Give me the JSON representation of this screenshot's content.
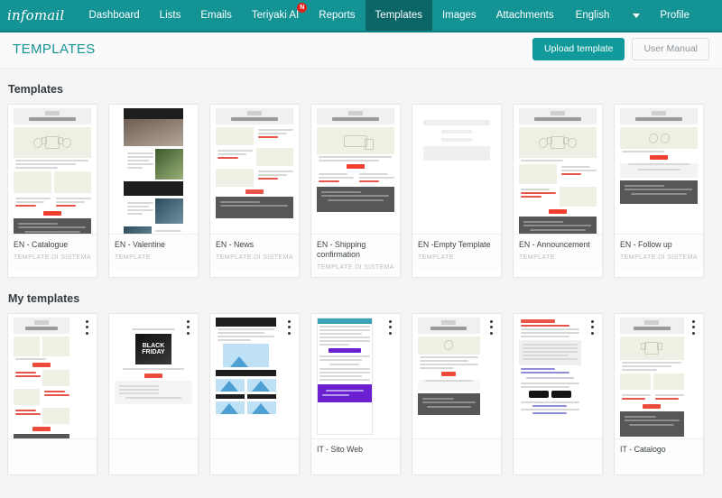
{
  "nav": {
    "logo": "infomail",
    "items": [
      {
        "label": "Dashboard",
        "active": false,
        "badge": null
      },
      {
        "label": "Lists",
        "active": false,
        "badge": null
      },
      {
        "label": "Emails",
        "active": false,
        "badge": null
      },
      {
        "label": "Teriyaki AI",
        "active": false,
        "badge": "N"
      },
      {
        "label": "Reports",
        "active": false,
        "badge": null
      },
      {
        "label": "Templates",
        "active": true,
        "badge": null
      },
      {
        "label": "Images",
        "active": false,
        "badge": null
      },
      {
        "label": "Attachments",
        "active": false,
        "badge": null
      }
    ],
    "language": "English",
    "profile": "Profile"
  },
  "header": {
    "title": "TEMPLATES",
    "upload_label": "Upload template",
    "manual_label": "User Manual"
  },
  "sections": [
    {
      "title": "Templates",
      "cards": [
        {
          "name": "EN - Catalogue",
          "kind": "TEMPLATE DI SISTEMA"
        },
        {
          "name": "EN - Valentine",
          "kind": "TEMPLATE"
        },
        {
          "name": "EN - News",
          "kind": "TEMPLATE DI SISTEMA"
        },
        {
          "name": "EN - Shipping confirmation",
          "kind": "TEMPLATE DI SISTEMA"
        },
        {
          "name": "EN -Empty Template",
          "kind": "TEMPLATE"
        },
        {
          "name": "EN - Announcement",
          "kind": "TEMPLATE"
        },
        {
          "name": "EN - Follow up",
          "kind": "TEMPLATE DI SISTEMA"
        }
      ]
    },
    {
      "title": "My templates",
      "cards": [
        {
          "name": "",
          "kind": ""
        },
        {
          "name": "",
          "kind": ""
        },
        {
          "name": "",
          "kind": ""
        },
        {
          "name": "IT - Sito Web",
          "kind": ""
        },
        {
          "name": "",
          "kind": ""
        },
        {
          "name": "",
          "kind": ""
        },
        {
          "name": "IT - Catalogo",
          "kind": ""
        }
      ]
    }
  ],
  "mock_text": {
    "black_friday": "BLACK FRIDAY"
  },
  "colors": {
    "brand": "#149395",
    "brand_dark": "#0b6668",
    "accent_red": "#e2231a",
    "page_bg": "#f4f4f4"
  }
}
